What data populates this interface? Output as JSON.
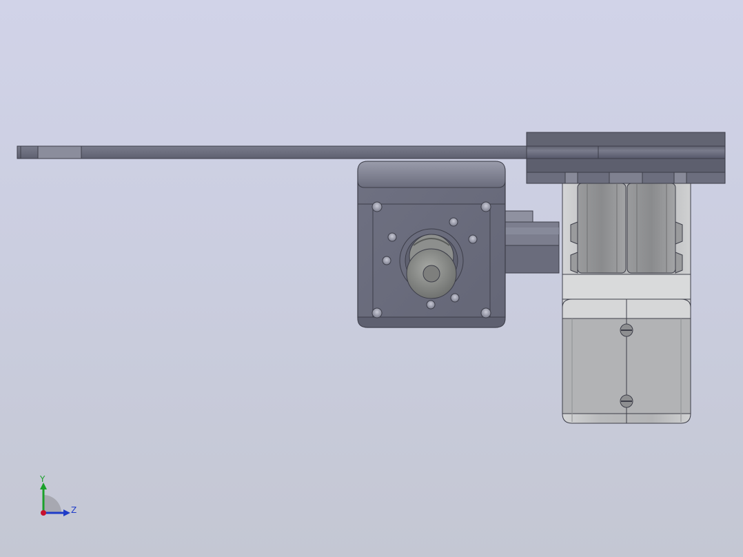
{
  "viewport": {
    "background_top": "#d1d3e8",
    "background_bottom": "#c4c7d3"
  },
  "model": {
    "plate_color": "#6e7080",
    "motor_housing_color": "#6d6f80",
    "gearbox_color": "#bfc0c3",
    "shaft_color": "#8a8c8a"
  },
  "triad": {
    "y_label": "Y",
    "z_label": "Z",
    "y_color": "#1aa12a",
    "z_color": "#1f3cc8",
    "x_color": "#c8102e"
  }
}
